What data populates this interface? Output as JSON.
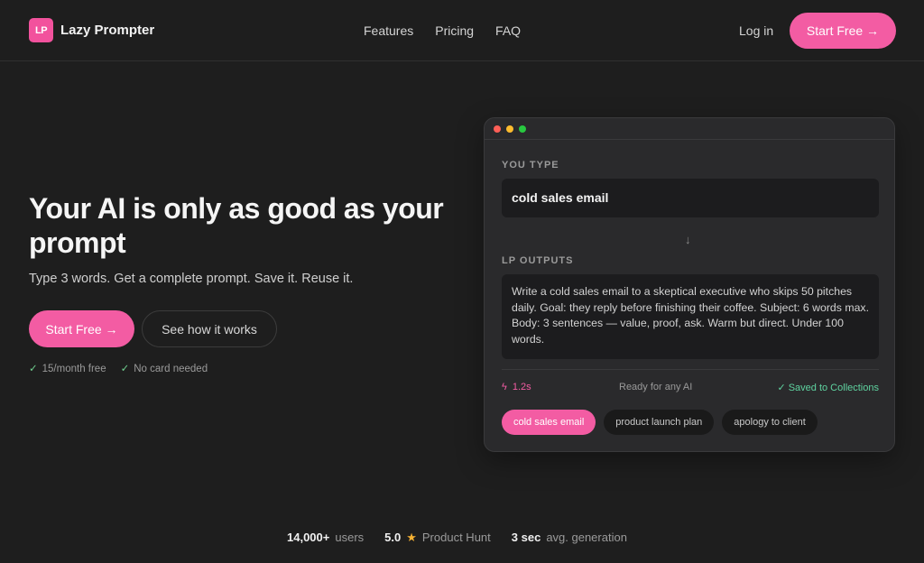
{
  "header": {
    "logo_mark": "LP",
    "brand_name": "Lazy Prompter",
    "nav": [
      "Features",
      "Pricing",
      "FAQ"
    ],
    "login": "Log in",
    "cta": "Start Free →"
  },
  "hero": {
    "title": "Your AI is only as good as your prompt",
    "subtitle": "Type 3 words. Get a complete prompt. Save it. Reuse it.",
    "cta_primary": "Start Free →",
    "cta_secondary": "See how it works",
    "checks": [
      "15/month free",
      "No card needed"
    ]
  },
  "demo": {
    "you_type_label": "YOU TYPE",
    "input_text": "cold sales email",
    "outputs_label": "LP OUTPUTS",
    "output_text": "Write a cold sales email to a skeptical executive who skips 50 pitches daily. Goal: they reply before finishing their coffee. Subject: 6 words max. Body: 3 sentences — value, proof, ask. Warm but direct. Under 100 words.",
    "time": "1.2s",
    "ready": "Ready for any AI",
    "saved": "✓ Saved to Collections",
    "chips": [
      "cold sales email",
      "product launch plan",
      "apology to client"
    ]
  },
  "stats": {
    "users_num": "14,000+",
    "users_txt": "users",
    "rating_num": "5.0",
    "rating_txt": "Product Hunt",
    "speed_num": "3 sec",
    "speed_txt": "avg. generation"
  },
  "colors": {
    "accent": "#f35ca3",
    "background": "#1e1e1e",
    "card": "#2a2a2c",
    "success": "#5fd3a0"
  }
}
